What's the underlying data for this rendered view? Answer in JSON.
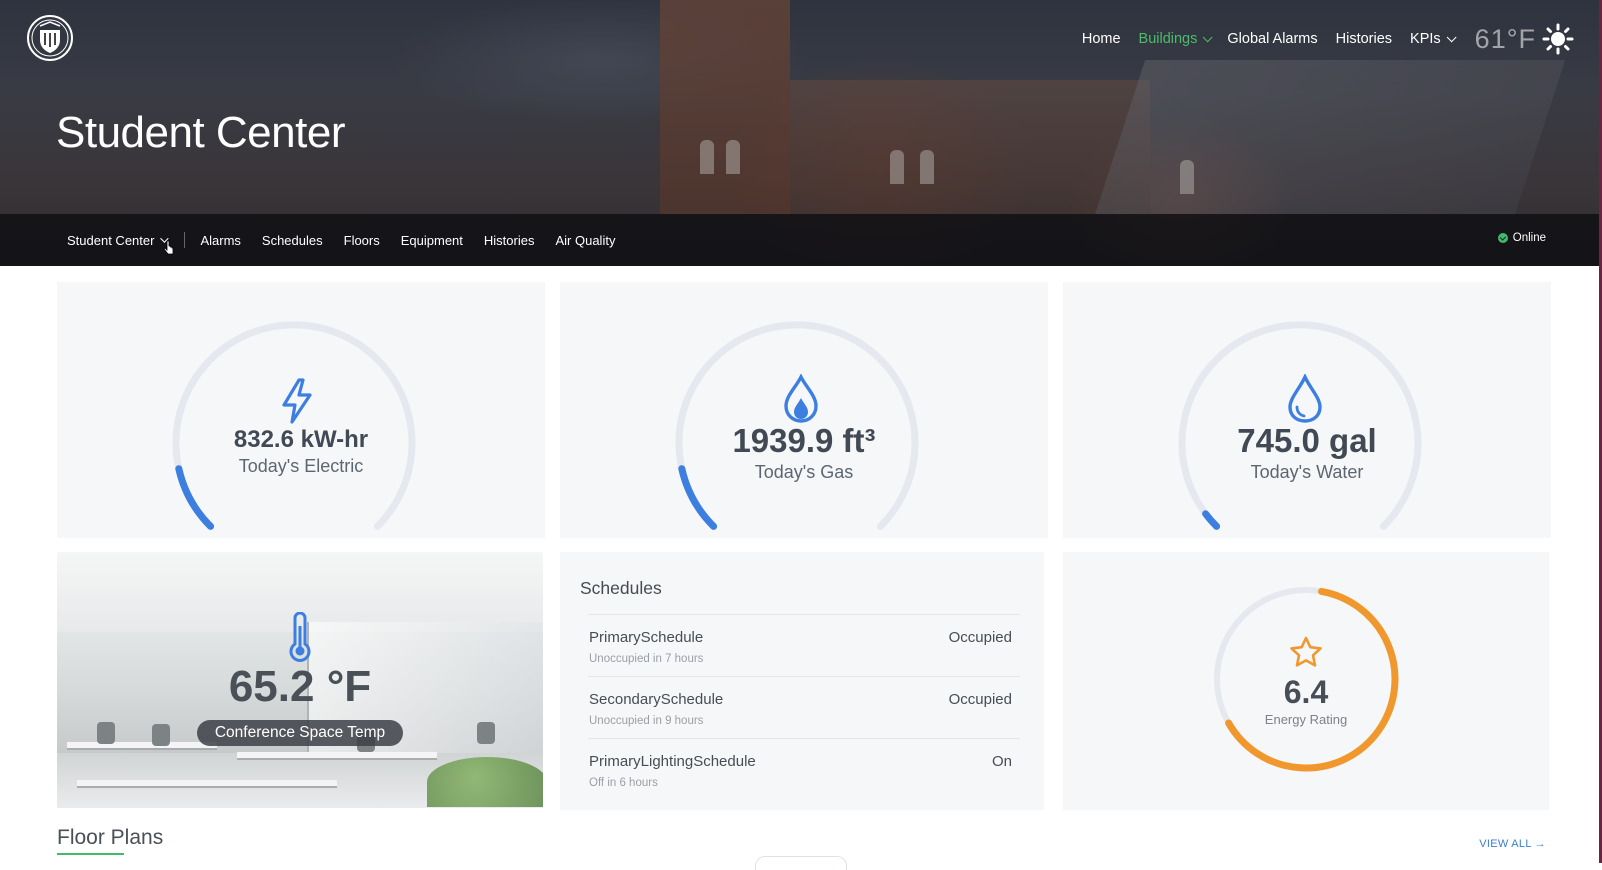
{
  "header": {
    "logo_icon": "university-crest-icon",
    "nav": [
      {
        "label": "Home",
        "active": false,
        "dropdown": false
      },
      {
        "label": "Buildings",
        "active": true,
        "dropdown": true
      },
      {
        "label": "Global Alarms",
        "active": false,
        "dropdown": false
      },
      {
        "label": "Histories",
        "active": false,
        "dropdown": false
      },
      {
        "label": "KPIs",
        "active": false,
        "dropdown": true
      }
    ],
    "weather": {
      "temp": "61°F",
      "icon": "sun-icon"
    },
    "accent_color": "#4cbb6b"
  },
  "page": {
    "title": "Student Center"
  },
  "subnav": {
    "building_select": "Student Center",
    "items": [
      "Alarms",
      "Schedules",
      "Floors",
      "Equipment",
      "Histories",
      "Air Quality"
    ],
    "status": "Online",
    "status_color": "#43b96a"
  },
  "gauges": [
    {
      "value": "832.6 kW-hr",
      "label": "Today's Electric",
      "icon": "lightning-bolt-icon",
      "fill": 0.12,
      "color": "#3d7fe0"
    },
    {
      "value": "1939.9 ft³",
      "label": "Today's Gas",
      "icon": "flame-icon",
      "fill": 0.12,
      "color": "#3d7fe0"
    },
    {
      "value": "745.0 gal",
      "label": "Today's Water",
      "icon": "water-drop-icon",
      "fill": 0.03,
      "color": "#3d7fe0"
    }
  ],
  "temperature": {
    "value": "65.2 °F",
    "label": "Conference Space Temp",
    "icon": "thermometer-icon"
  },
  "schedules": {
    "title": "Schedules",
    "rows": [
      {
        "name": "PrimarySchedule",
        "sub": "Unoccupied in 7 hours",
        "status": "Occupied"
      },
      {
        "name": "SecondarySchedule",
        "sub": "Unoccupied in 9 hours",
        "status": "Occupied"
      },
      {
        "name": "PrimaryLightingSchedule",
        "sub": "Off in 6 hours",
        "status": "On"
      }
    ]
  },
  "energy_rating": {
    "value": "6.4",
    "label": "Energy Rating",
    "icon": "star-icon",
    "fill": 0.64,
    "color": "#f0982d"
  },
  "floor_plans": {
    "title": "Floor Plans",
    "view_all": "VIEW ALL →"
  }
}
